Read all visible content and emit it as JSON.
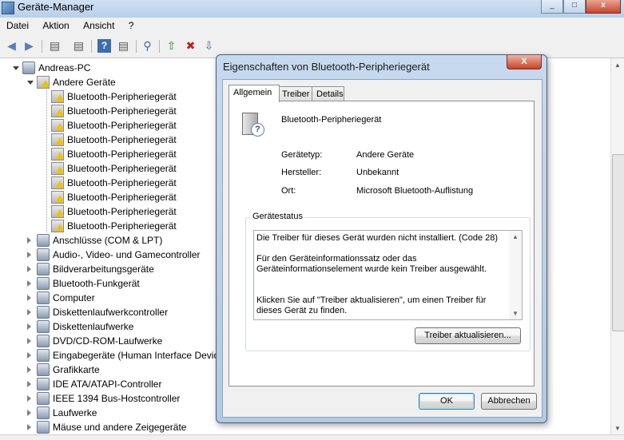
{
  "window": {
    "title": "Geräte-Manager"
  },
  "menu": [
    "Datei",
    "Aktion",
    "Ansicht",
    "?"
  ],
  "toolbar": {
    "icons": [
      "back-arrow-icon",
      "forward-arrow-icon",
      "console-tree-icon",
      "properties-icon",
      "help-icon",
      "action-pane-icon",
      "scan-hardware-icon",
      "update-driver-icon",
      "uninstall-icon",
      "disable-icon"
    ]
  },
  "tree": {
    "root": "Andreas-PC",
    "other_devices": "Andere Geräte",
    "bt_items": [
      "Bluetooth-Peripheriegerät",
      "Bluetooth-Peripheriegerät",
      "Bluetooth-Peripheriegerät",
      "Bluetooth-Peripheriegerät",
      "Bluetooth-Peripheriegerät",
      "Bluetooth-Peripheriegerät",
      "Bluetooth-Peripheriegerät",
      "Bluetooth-Peripheriegerät",
      "Bluetooth-Peripheriegerät",
      "Bluetooth-Peripheriegerät"
    ],
    "categories": [
      {
        "label": "Anschlüsse (COM & LPT)",
        "icon": "port-icon"
      },
      {
        "label": "Audio-, Video- und Gamecontroller",
        "icon": "speaker-icon"
      },
      {
        "label": "Bildverarbeitungsgeräte",
        "icon": "camera-icon"
      },
      {
        "label": "Bluetooth-Funkgerät",
        "icon": "bluetooth-icon"
      },
      {
        "label": "Computer",
        "icon": "computer-icon"
      },
      {
        "label": "Diskettenlaufwerkcontroller",
        "icon": "floppy-controller-icon"
      },
      {
        "label": "Diskettenlaufwerke",
        "icon": "floppy-drive-icon"
      },
      {
        "label": "DVD/CD-ROM-Laufwerke",
        "icon": "dvd-drive-icon"
      },
      {
        "label": "Eingabegeräte (Human Interface Devic",
        "icon": "hid-icon"
      },
      {
        "label": "Grafikkarte",
        "icon": "display-adapter-icon"
      },
      {
        "label": "IDE ATA/ATAPI-Controller",
        "icon": "ide-controller-icon"
      },
      {
        "label": "IEEE 1394 Bus-Hostcontroller",
        "icon": "firewire-icon"
      },
      {
        "label": "Laufwerke",
        "icon": "disk-drive-icon"
      },
      {
        "label": "Mäuse und andere Zeigegeräte",
        "icon": "mouse-icon"
      }
    ]
  },
  "dialog": {
    "title": "Eigenschaften von Bluetooth-Peripheriegerät",
    "close": "X",
    "tabs": [
      "Allgemein",
      "Treiber",
      "Details"
    ],
    "device_name": "Bluetooth-Peripheriegerät",
    "props": [
      {
        "label": "Gerätetyp:",
        "value": "Andere Geräte"
      },
      {
        "label": "Hersteller:",
        "value": "Unbekannt"
      },
      {
        "label": "Ort:",
        "value": "Microsoft Bluetooth-Auflistung"
      }
    ],
    "status_title": "Gerätestatus",
    "status_text": "Die Treiber für dieses Gerät wurden nicht installiert. (Code 28)\n\nFür den Geräteinformationssatz oder das Geräteinformationselement wurde kein Treiber ausgewählt.\n\n\nKlicken Sie auf \"Treiber aktualisieren\", um einen Treiber für dieses Gerät zu finden.",
    "update_button": "Treiber aktualisieren...",
    "ok": "OK",
    "cancel": "Abbrechen"
  }
}
